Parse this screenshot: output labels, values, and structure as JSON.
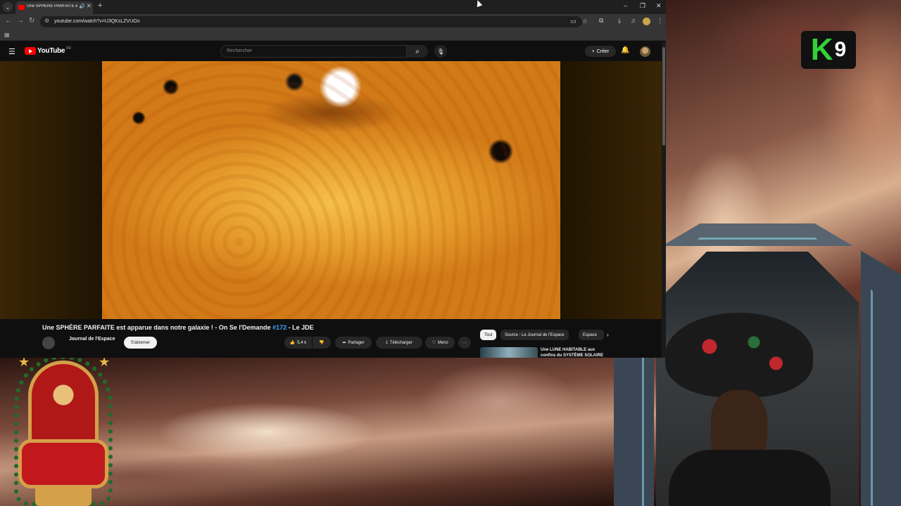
{
  "browser": {
    "tab_title": "Une SPHÈRE PARFAITE est apparue dans notre galaxie",
    "tab_title_shown": "Une SPHÈRE PARFAITE est",
    "new_tab_label": "+",
    "url": "youtube.com/watch?v=U3QKsLZVUOo",
    "window_controls": [
      "–",
      "❐",
      "✕"
    ]
  },
  "youtube": {
    "logo_text": "YouTube",
    "logo_region": "FR",
    "search_placeholder": "Rechercher",
    "create_label": "Créer",
    "video": {
      "title": "Une SPHÈRE PARFAITE est apparue dans notre galaxie ! - On Se l'Demande ",
      "hashtag": "#172",
      "title_suffix": " - Le JDE",
      "channel_name": "Journal de l'Espace",
      "subscribe_label": "S'abonner",
      "likes": "5,4 k",
      "share_label": "Partager",
      "download_label": "Télécharger",
      "thanks_label": "Merci",
      "more_label": "···"
    },
    "chips": [
      "Tout",
      "Source : Le Journal de l'Espace",
      "Espace"
    ],
    "recommendation_title": "Une LUNE HABITABLE aux confins du SYSTÈME SOLAIRE"
  },
  "overlay": {
    "logo_k": "K",
    "logo_9": "9"
  },
  "colors": {
    "youtube_red": "#ff0000",
    "overlay_green": "#32d13a",
    "link_blue": "#3ea6ff"
  }
}
